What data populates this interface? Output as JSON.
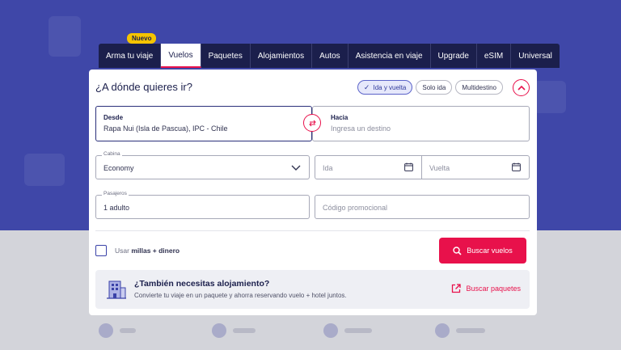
{
  "badge": "Nuevo",
  "tabs": [
    {
      "label": "Arma tu viaje"
    },
    {
      "label": "Vuelos"
    },
    {
      "label": "Paquetes"
    },
    {
      "label": "Alojamientos"
    },
    {
      "label": "Autos"
    },
    {
      "label": "Asistencia en viaje"
    },
    {
      "label": "Upgrade"
    },
    {
      "label": "eSIM"
    },
    {
      "label": "Universal"
    }
  ],
  "active_tab": "Vuelos",
  "search": {
    "title": "¿A dónde quieres ir?",
    "trip_types": [
      "Ida y vuelta",
      "Solo ida",
      "Multidestino"
    ],
    "selected_trip_type": "Ida y vuelta",
    "desde": {
      "label": "Desde",
      "value": "Rapa Nui (Isla de Pascua), IPC - Chile"
    },
    "hacia": {
      "label": "Hacia",
      "placeholder": "Ingresa un destino"
    },
    "cabina": {
      "label": "Cabina",
      "value": "Economy"
    },
    "ida": {
      "placeholder": "Ida"
    },
    "vuelta": {
      "placeholder": "Vuelta"
    },
    "pasajeros": {
      "label": "Pasajeros",
      "value": "1 adulto"
    },
    "promo_code": {
      "placeholder": "Código promocional"
    },
    "miles": {
      "prefix": "Usar",
      "bold": "millas + dinero"
    },
    "search_button": "Buscar vuelos"
  },
  "lodging_promo": {
    "title": "¿También necesitas alojamiento?",
    "subtitle": "Convierte tu viaje en un paquete y ahorra reservando vuelo + hotel juntos.",
    "link": "Buscar paquetes"
  },
  "colors": {
    "accent": "#e8114b",
    "navy": "#1b1f4c",
    "hero": "#3f47a8"
  },
  "icons": [
    "check-icon",
    "chevron-up-icon",
    "swap-icon",
    "chevron-down-icon",
    "calendar-icon",
    "search-icon",
    "hotel-icon",
    "external-link-icon"
  ]
}
